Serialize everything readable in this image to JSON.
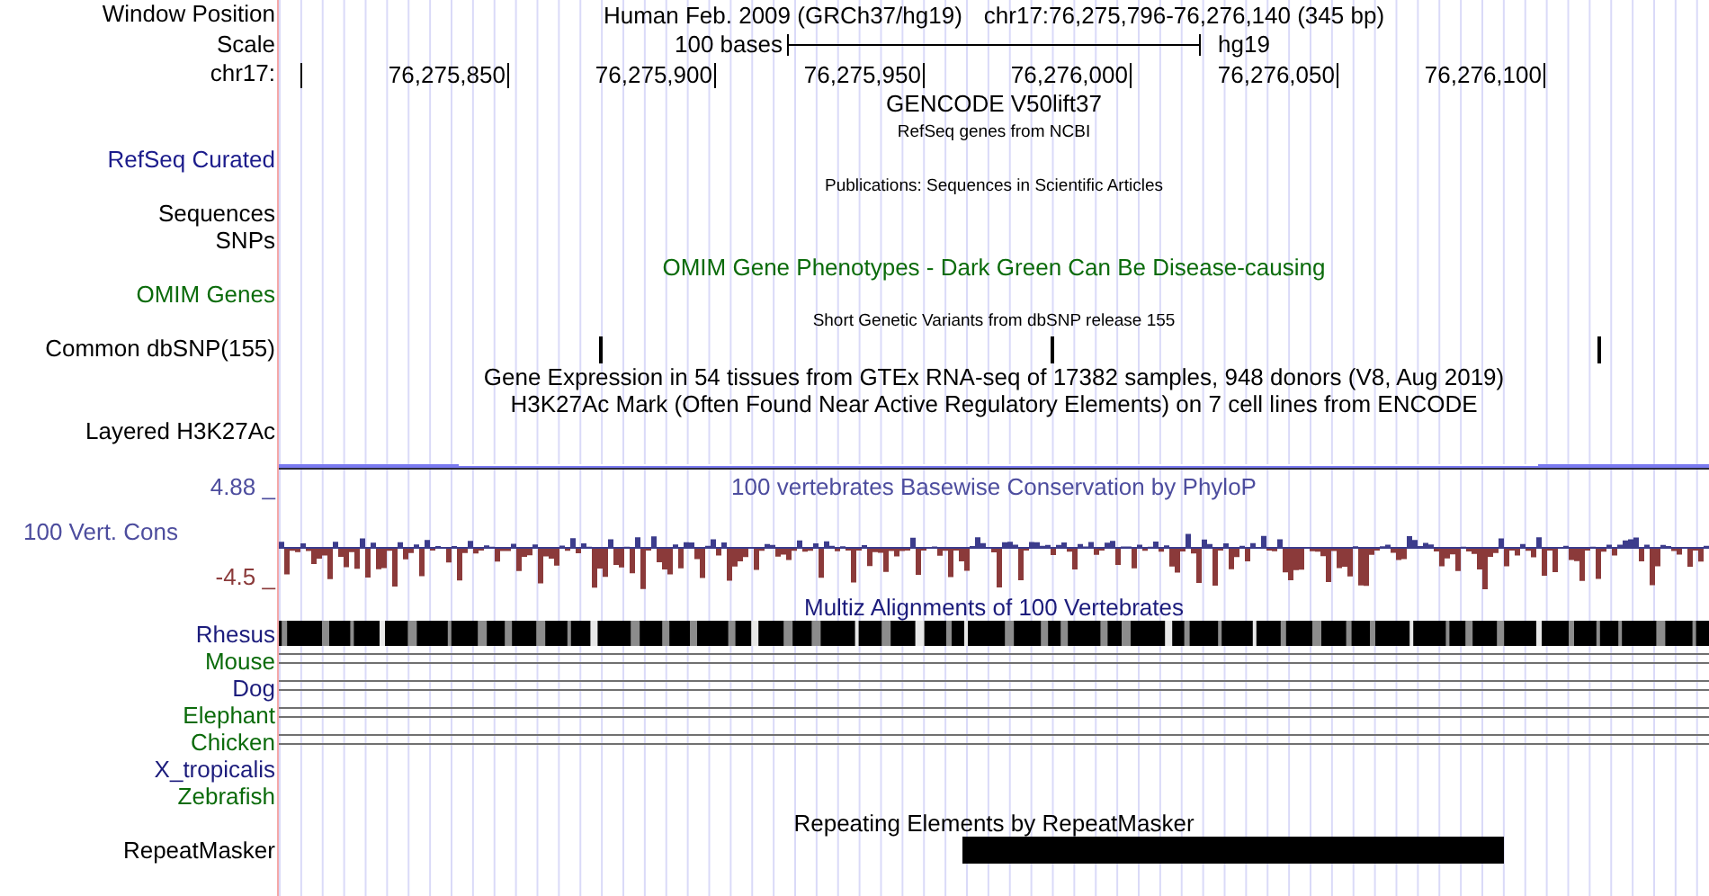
{
  "header": {
    "window_position_label": "Window Position",
    "assembly": "Human Feb. 2009 (GRCh37/hg19)",
    "position": "chr17:76,275,796-76,276,140 (345 bp)",
    "scale_label": "Scale",
    "scale_text": "100 bases",
    "scale_db": "hg19",
    "chrom_label": "chr17:",
    "ticks": [
      "76,275,850",
      "76,275,900",
      "76,275,950",
      "76,276,000",
      "76,276,050",
      "76,276,100"
    ]
  },
  "tracks": [
    {
      "kind": "gencode",
      "title": "GENCODE V50lift37"
    },
    {
      "kind": "refseq",
      "title": "RefSeq genes from NCBI",
      "label": "RefSeq Curated",
      "color": "#1c1c8c"
    },
    {
      "kind": "publications",
      "title": "Publications: Sequences in Scientific Articles",
      "label_lines": [
        "Sequences",
        "SNPs"
      ]
    },
    {
      "kind": "omim",
      "title": "OMIM Gene Phenotypes - Dark Green Can Be Disease-causing",
      "label": "OMIM Genes",
      "color": "#0b6b0b"
    },
    {
      "kind": "dbsnp",
      "title": "Short Genetic Variants from dbSNP release 155",
      "label": "Common dbSNP(155)"
    },
    {
      "kind": "gtex",
      "title": "Gene Expression in 54 tissues from GTEx RNA-seq of 17382 samples, 948 donors (V8, Aug 2019)"
    },
    {
      "kind": "h3k27ac",
      "title": "H3K27Ac Mark (Often Found Near Active Regulatory Elements) on 7 cell lines from ENCODE",
      "label": "Layered H3K27Ac"
    },
    {
      "kind": "conservation",
      "title": "100 vertebrates Basewise Conservation by PhyloP",
      "label": "100 Vert. Cons",
      "max": "4.88 _",
      "min": "-4.5 _",
      "color": "#4d4d9e"
    },
    {
      "kind": "multiz",
      "title": "Multiz Alignments of 100 Vertebrates",
      "species": [
        {
          "name": "Rhesus",
          "color": "#1c1c7c",
          "kind": "blocks"
        },
        {
          "name": "Mouse",
          "color": "#0b6b0b",
          "kind": "lines"
        },
        {
          "name": "Dog",
          "color": "#1c1c7c",
          "kind": "lines"
        },
        {
          "name": "Elephant",
          "color": "#0b6b0b",
          "kind": "lines"
        },
        {
          "name": "Chicken",
          "color": "#0b6b0b",
          "kind": "lines"
        },
        {
          "name": "X_tropicalis",
          "color": "#1c1c7c",
          "kind": "none"
        },
        {
          "name": "Zebrafish",
          "color": "#0b6b0b",
          "kind": "none"
        }
      ]
    },
    {
      "kind": "repeatmasker",
      "title": "Repeating Elements by RepeatMasker",
      "label": "RepeatMasker"
    }
  ]
}
